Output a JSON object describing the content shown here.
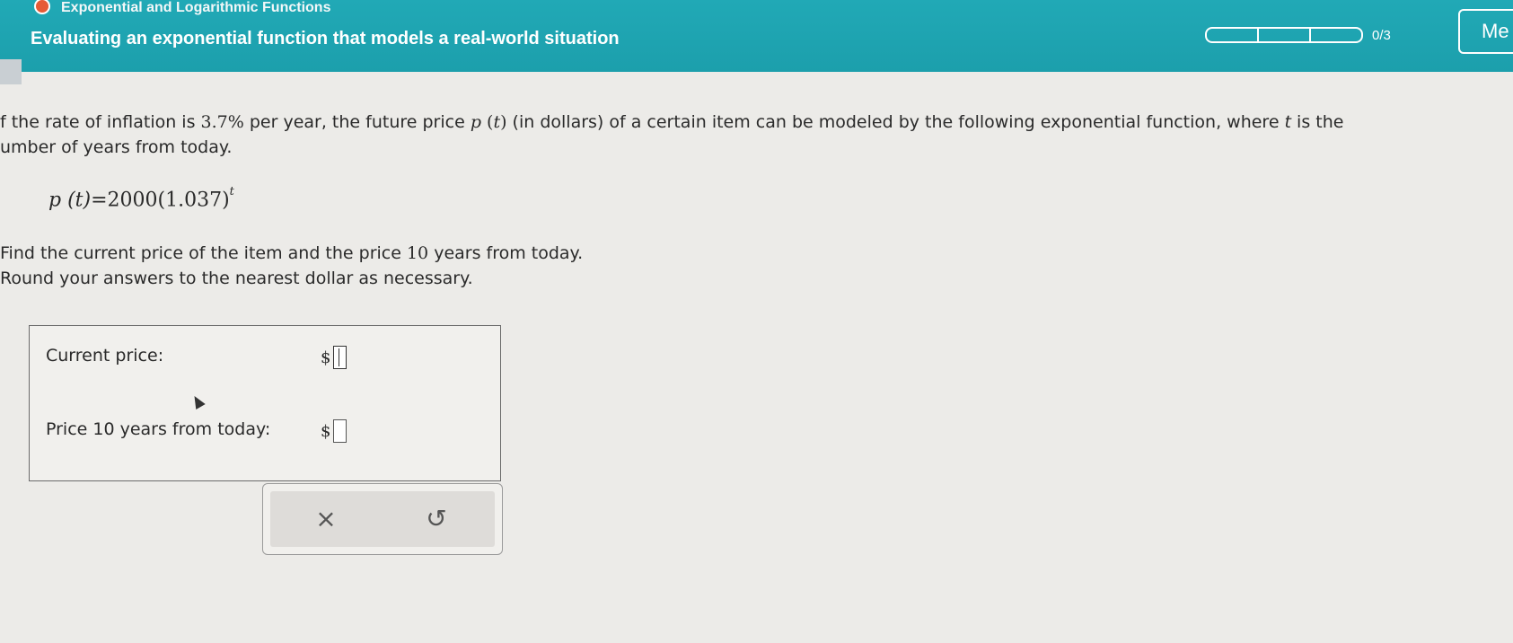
{
  "header": {
    "topic": "Exponential and Logarithmic Functions",
    "title": "Evaluating an exponential function that models a real-world situation",
    "progress_text": "0/3",
    "menu_label": "Me"
  },
  "question": {
    "line1_a": "f the rate of inflation is ",
    "rate": "3.7%",
    "line1_b": " per year, the future price ",
    "func_p": "p",
    "func_t": "t",
    "line1_c": " (in dollars) of a certain item can be modeled by the following exponential function, where ",
    "t_var": "t",
    "line1_d": " is the",
    "line2": "umber of years from today.",
    "formula_lhs": "p (t)",
    "formula_rhs": "=2000(1.037)",
    "formula_exp": "t",
    "find_a": "Find the current price of the item and the price ",
    "find_num": "10",
    "find_b": " years from today.",
    "round": "Round your answers to the nearest dollar as necessary."
  },
  "answers": {
    "current_label": "Current price:",
    "future_label": "Price 10 years from today:",
    "currency": "$",
    "current_value": "",
    "future_value": ""
  },
  "buttons": {
    "clear": "×",
    "reset": "↺"
  }
}
